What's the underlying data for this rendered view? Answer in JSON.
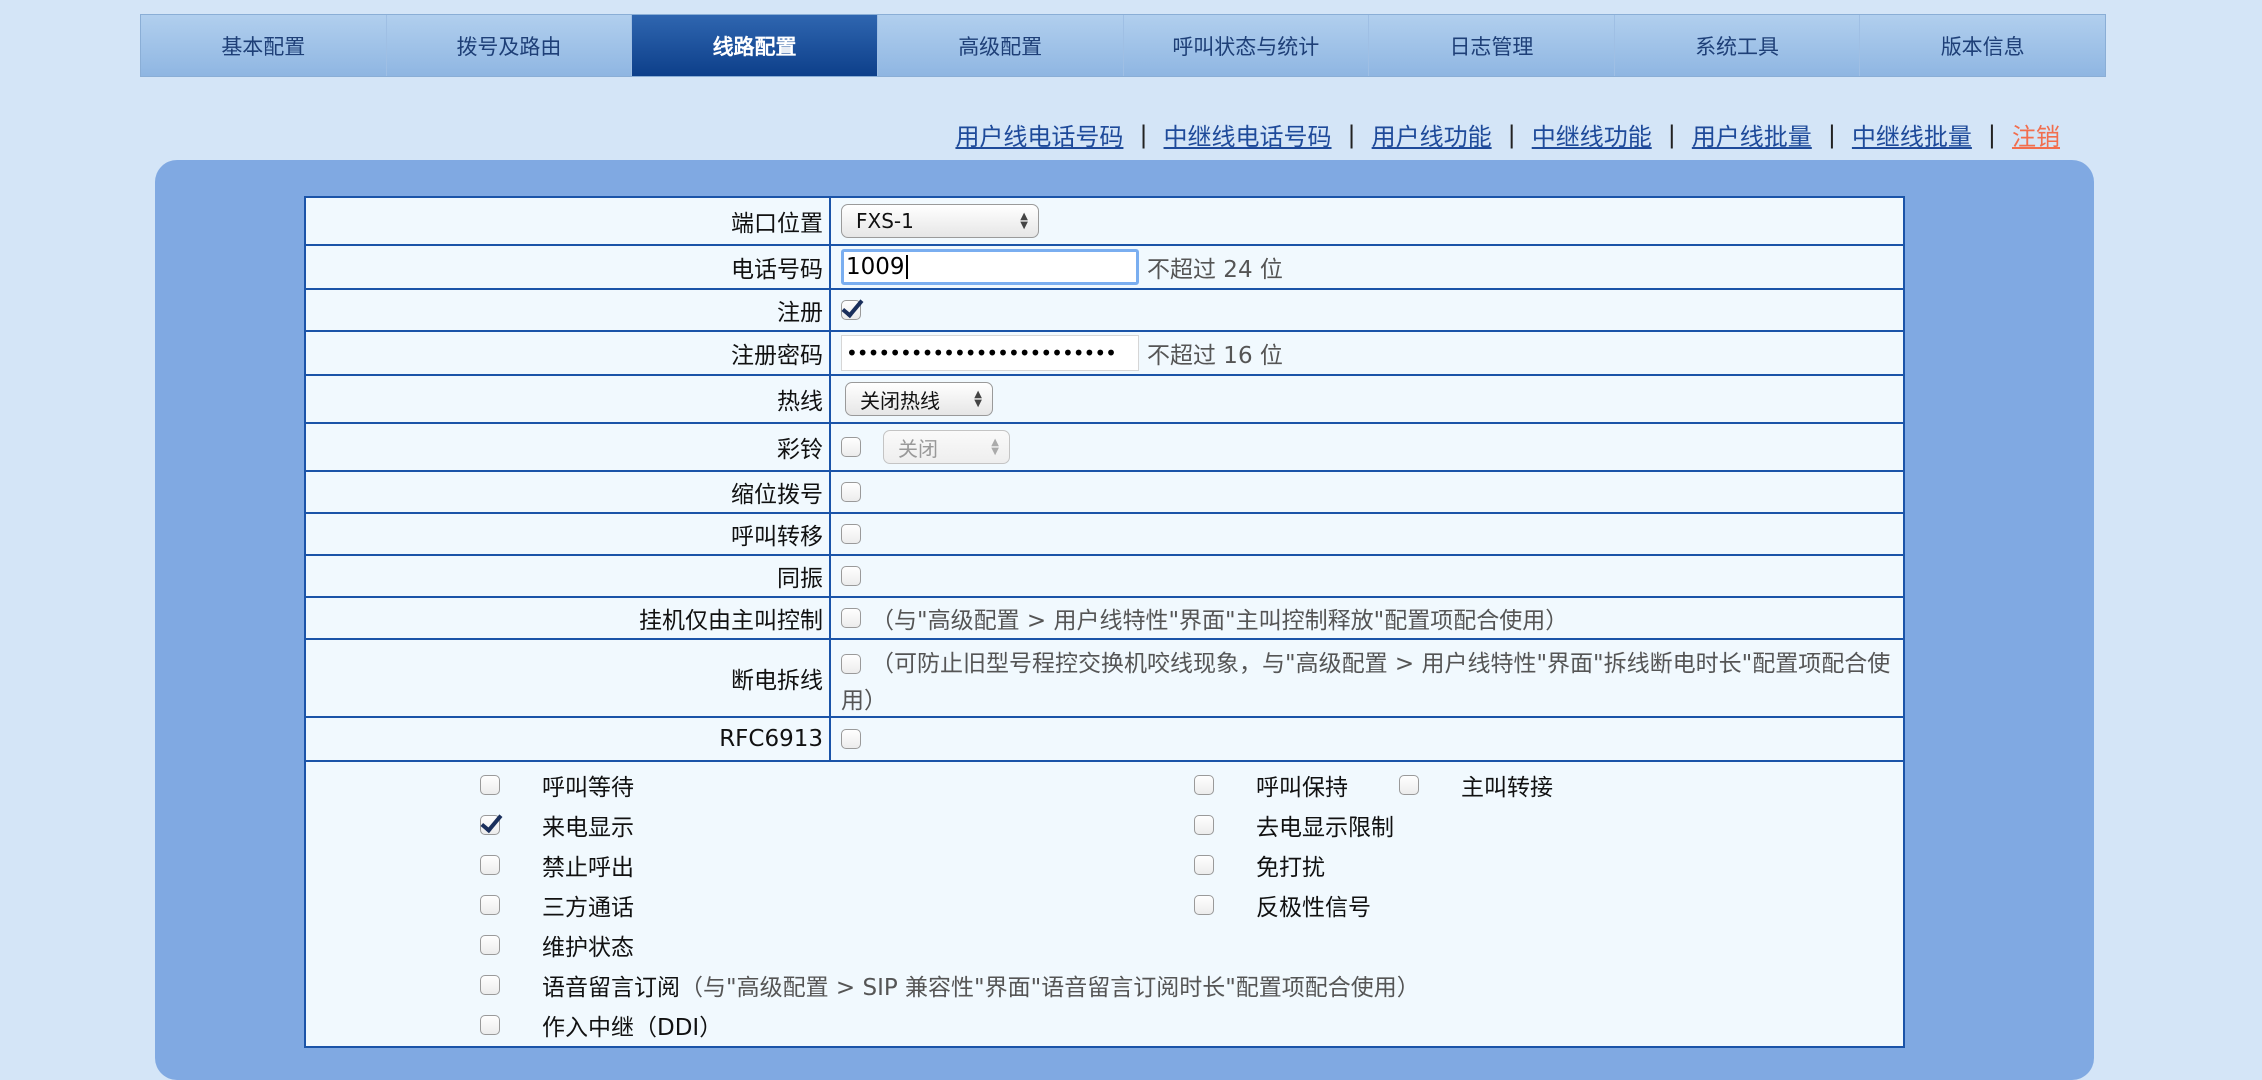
{
  "nav": {
    "tabs": [
      {
        "label": "基本配置",
        "active": false
      },
      {
        "label": "拨号及路由",
        "active": false
      },
      {
        "label": "线路配置",
        "active": true
      },
      {
        "label": "高级配置",
        "active": false
      },
      {
        "label": "呼叫状态与统计",
        "active": false
      },
      {
        "label": "日志管理",
        "active": false
      },
      {
        "label": "系统工具",
        "active": false
      },
      {
        "label": "版本信息",
        "active": false
      }
    ]
  },
  "sublinks": {
    "items": [
      "用户线电话号码",
      "中继线电话号码",
      "用户线功能",
      "中继线功能",
      "用户线批量",
      "中继线批量"
    ],
    "logout": "注销",
    "separator": "|"
  },
  "form": {
    "port": {
      "label": "端口位置",
      "value": "FXS-1"
    },
    "phone": {
      "label": "电话号码",
      "value": "1009",
      "hint": "不超过 24 位"
    },
    "register": {
      "label": "注册",
      "checked": true
    },
    "reg_password": {
      "label": "注册密码",
      "value": "•••••••••••••••••••••••••",
      "hint": "不超过 16 位"
    },
    "hotline": {
      "label": "热线",
      "value": "关闭热线"
    },
    "ringback": {
      "label": "彩铃",
      "checked": false,
      "select_value": "关闭"
    },
    "abbr_dial": {
      "label": "缩位拨号",
      "checked": false
    },
    "call_forward": {
      "label": "呼叫转移",
      "checked": false
    },
    "simul_ring": {
      "label": "同振",
      "checked": false
    },
    "onhook_caller": {
      "label": "挂机仅由主叫控制",
      "checked": false,
      "note": "（与\"高级配置 > 用户线特性\"界面\"主叫控制释放\"配置项配合使用）"
    },
    "power_cut": {
      "label": "断电拆线",
      "checked": false,
      "note": "（可防止旧型号程控交换机咬线现象，与\"高级配置 > 用户线特性\"界面\"拆线断电时长\"配置项配合使用）"
    },
    "rfc6913": {
      "label": "RFC6913",
      "checked": false
    }
  },
  "features": {
    "call_waiting": {
      "label": "呼叫等待",
      "checked": false
    },
    "call_hold": {
      "label": "呼叫保持",
      "checked": false
    },
    "caller_transfer": {
      "label": "主叫转接",
      "checked": false
    },
    "caller_id": {
      "label": "来电显示",
      "checked": true
    },
    "outgoing_id_restrict": {
      "label": "去电显示限制",
      "checked": false
    },
    "outgoing_barred": {
      "label": "禁止呼出",
      "checked": false
    },
    "dnd": {
      "label": "免打扰",
      "checked": false
    },
    "three_way": {
      "label": "三方通话",
      "checked": false
    },
    "polarity": {
      "label": "反极性信号",
      "checked": false
    },
    "maintenance": {
      "label": "维护状态",
      "checked": false
    },
    "voicemail_sub": {
      "label": "语音留言订阅",
      "checked": false,
      "note": "（与\"高级配置 > SIP 兼容性\"界面\"语音留言订阅时长\"配置项配合使用）"
    },
    "ddi": {
      "label": "作入中继（DDI）",
      "checked": false
    }
  }
}
